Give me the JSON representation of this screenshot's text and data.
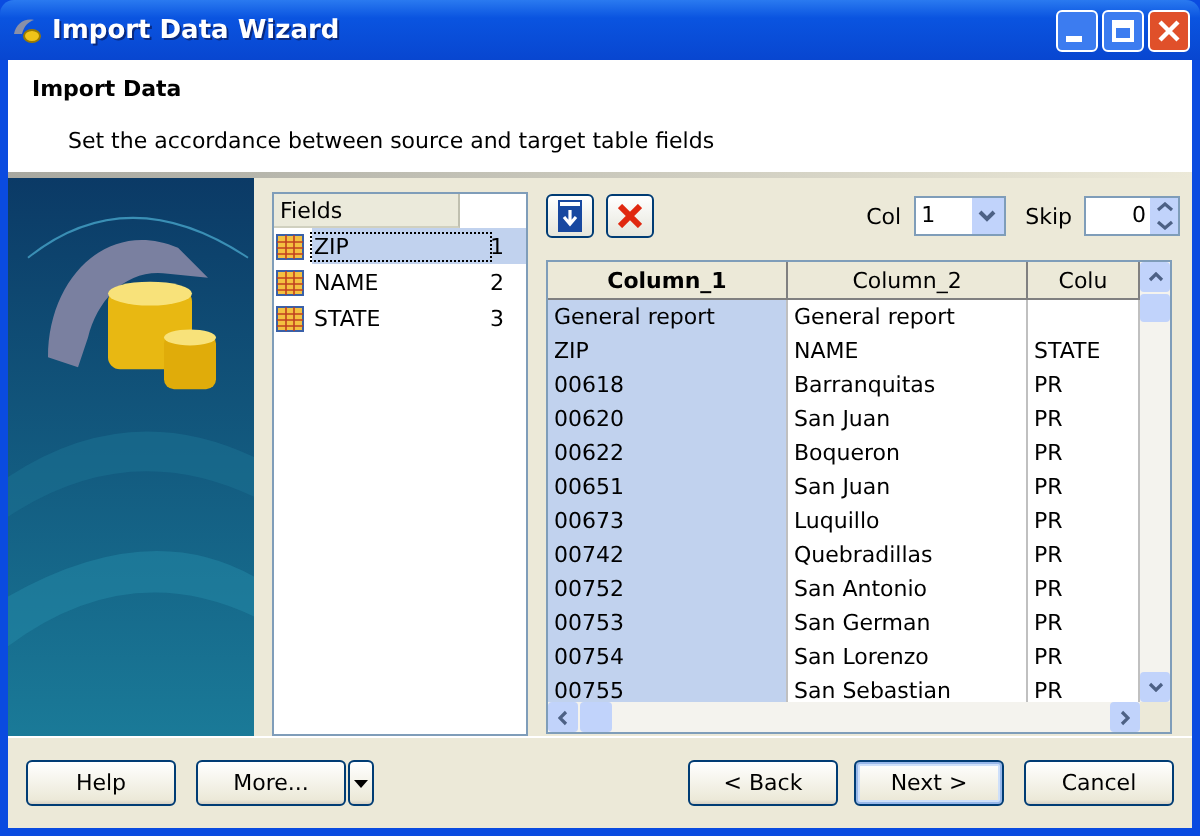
{
  "window": {
    "title": "Import Data Wizard"
  },
  "header": {
    "title": "Import Data",
    "subtitle": "Set the accordance between source and target table fields"
  },
  "fields": {
    "heading": "Fields",
    "items": [
      {
        "name": "ZIP",
        "number": "1",
        "selected": true
      },
      {
        "name": "NAME",
        "number": "2",
        "selected": false
      },
      {
        "name": "STATE",
        "number": "3",
        "selected": false
      }
    ]
  },
  "toolbar": {
    "col_label": "Col",
    "col_value": "1",
    "skip_label": "Skip",
    "skip_value": "0"
  },
  "grid": {
    "columns": [
      {
        "label": "Column_1",
        "selected": true
      },
      {
        "label": "Column_2",
        "selected": false
      },
      {
        "label": "Colu",
        "selected": false
      }
    ],
    "rows": [
      [
        "General report",
        "General report",
        ""
      ],
      [
        "ZIP",
        "NAME",
        "STATE"
      ],
      [
        "00618",
        "Barranquitas",
        "PR"
      ],
      [
        "00620",
        "San Juan",
        "PR"
      ],
      [
        "00622",
        "Boqueron",
        "PR"
      ],
      [
        "00651",
        "San Juan",
        "PR"
      ],
      [
        "00673",
        "Luquillo",
        "PR"
      ],
      [
        "00742",
        "Quebradillas",
        "PR"
      ],
      [
        "00752",
        "San Antonio",
        "PR"
      ],
      [
        "00753",
        "San German",
        "PR"
      ],
      [
        "00754",
        "San Lorenzo",
        "PR"
      ],
      [
        "00755",
        "San Sebastian",
        "PR"
      ]
    ]
  },
  "buttons": [
    {
      "label": "Help",
      "kind": "plain",
      "default": false
    },
    {
      "label": "More...",
      "kind": "split",
      "default": false
    },
    {
      "label": "< Back",
      "kind": "plain",
      "default": false
    },
    {
      "label": "Next >",
      "kind": "plain",
      "default": true
    },
    {
      "label": "Cancel",
      "kind": "plain",
      "default": false
    }
  ]
}
